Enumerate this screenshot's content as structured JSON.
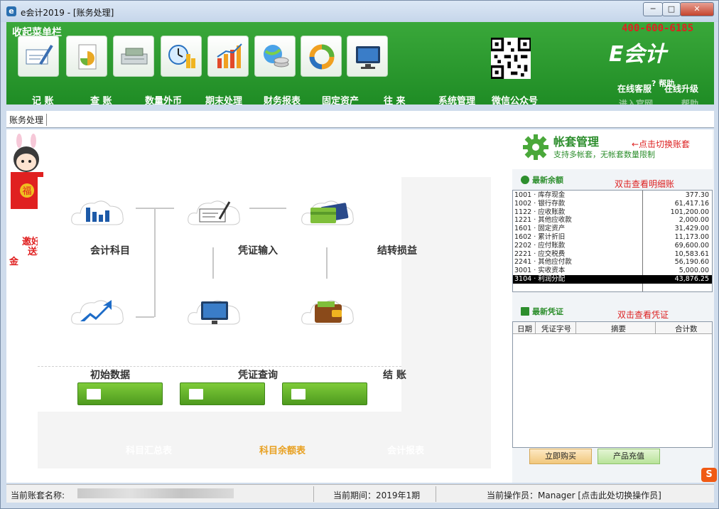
{
  "window": {
    "title": "e会计2019 - [账务处理]",
    "app_icon": "e",
    "min_label": "─",
    "max_label": "□",
    "close_label": "✕"
  },
  "banner": {
    "collapse_label": "收起菜单栏",
    "phone": "400-600-6185",
    "logo": "E会计",
    "links": [
      "在线客服",
      "帮助",
      "进入官网",
      "在线升级",
      "帮助"
    ],
    "help_icon": "?",
    "tools": [
      {
        "label": "记 账",
        "icon": "pen-document-icon"
      },
      {
        "label": "查 账",
        "icon": "pie-document-icon"
      },
      {
        "label": "数量外币",
        "icon": "cash-register-icon"
      },
      {
        "label": "期末处理",
        "icon": "clock-coins-icon"
      },
      {
        "label": "财务报表",
        "icon": "bar-chart-icon"
      },
      {
        "label": "固定资产",
        "icon": "globe-coins-icon"
      },
      {
        "label": "往 来",
        "icon": "ring-chart-icon"
      },
      {
        "label": "系统管理",
        "icon": "monitor-icon"
      },
      {
        "label": "微信公众号",
        "icon": "qr-code-icon"
      }
    ]
  },
  "tab": {
    "label": "账务处理"
  },
  "flow": {
    "invite": [
      "邀好友",
      "送现",
      "金"
    ],
    "nodes": {
      "subjects": "会计科目",
      "voucher_input": "凭证输入",
      "transfer": "结转损益",
      "initial": "初始数据",
      "voucher_query": "凭证查询",
      "close": "结 账"
    },
    "reports": [
      "科目汇总表",
      "科目余额表",
      "会计报表"
    ],
    "accent": "#e8a020"
  },
  "right": {
    "acct_title": "帐套管理",
    "acct_hint": "←点击切换账套",
    "acct_sub": "支持多帐套，无帐套数量限制",
    "balance_head": "最新余额",
    "balance_hint": "双击查看明细账",
    "balances": [
      {
        "name": "1001 · 库存现金",
        "value": "377.30"
      },
      {
        "name": "1002 · 银行存款",
        "value": "61,417.16"
      },
      {
        "name": "1122 · 应收账款",
        "value": "101,200.00"
      },
      {
        "name": "1221 · 其他应收款",
        "value": "2,000.00"
      },
      {
        "name": "1601 · 固定资产",
        "value": "31,429.00"
      },
      {
        "name": "1602 · 累计折旧",
        "value": "11,173.00"
      },
      {
        "name": "2202 · 应付账款",
        "value": "69,600.00"
      },
      {
        "name": "2221 · 应交税费",
        "value": "10,583.61"
      },
      {
        "name": "2241 · 其他应付款",
        "value": "56,190.60"
      },
      {
        "name": "3001 · 实收资本",
        "value": "5,000.00"
      },
      {
        "name": "3104 · 利润分配",
        "value": "43,876.25"
      }
    ],
    "voucher_head": "最新凭证",
    "voucher_hint": "双击查看凭证",
    "voucher_columns": [
      "日期",
      "凭证字号",
      "摘要",
      "合计数"
    ],
    "buy_label": "立即购买",
    "recharge_label": "产品充值",
    "sogou": "S",
    "brand_color": "#2d8e2d"
  },
  "status": {
    "account_label": "当前账套名称:",
    "period": "当前期间：2019年1期",
    "operator": "当前操作员：Manager [点击此处切换操作员]"
  }
}
